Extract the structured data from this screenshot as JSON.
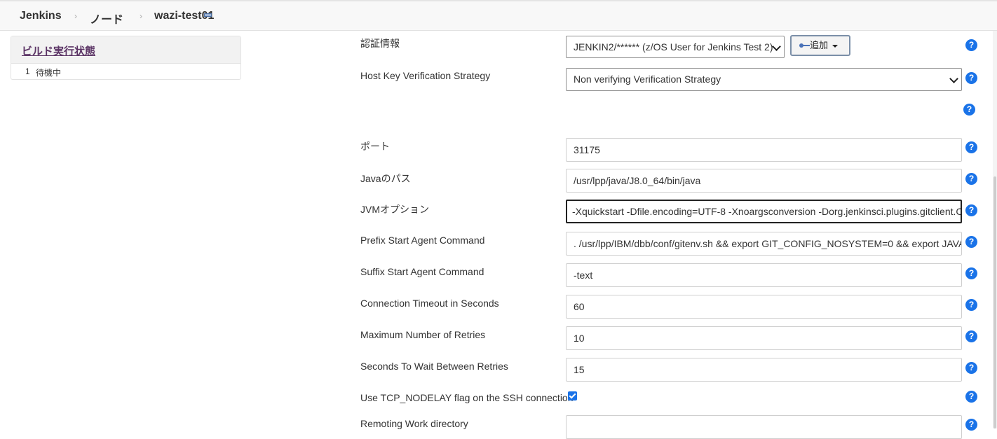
{
  "breadcrumb": {
    "items": [
      "Jenkins",
      "ノード",
      "wazi-test01"
    ],
    "separator": "›"
  },
  "sidebar": {
    "title": "ビルド実行状態",
    "executors": [
      {
        "number": "1",
        "status": "待機中"
      }
    ]
  },
  "form": {
    "credentials": {
      "label": "認証情報",
      "selected": "JENKIN2/****** (z/OS User for Jenkins Test 2)",
      "add_label": "追加"
    },
    "host_key": {
      "label": "Host Key Verification Strategy",
      "selected": "Non verifying Verification Strategy"
    },
    "port": {
      "label": "ポート",
      "value": "31175"
    },
    "java_path": {
      "label": "Javaのパス",
      "value": "/usr/lpp/java/J8.0_64/bin/java"
    },
    "jvm_options": {
      "label": "JVMオプション",
      "value": "-Xquickstart -Dfile.encoding=UTF-8 -Xnoargsconversion -Dorg.jenkinsci.plugins.gitclient.C"
    },
    "prefix_cmd": {
      "label": "Prefix Start Agent Command",
      "value": ". /usr/lpp/IBM/dbb/conf/gitenv.sh && export GIT_CONFIG_NOSYSTEM=0 && export JAVA"
    },
    "suffix_cmd": {
      "label": "Suffix Start Agent Command",
      "value": " -text"
    },
    "timeout": {
      "label": "Connection Timeout in Seconds",
      "value": "60"
    },
    "max_retries": {
      "label": "Maximum Number of Retries",
      "value": "10"
    },
    "retry_wait": {
      "label": "Seconds To Wait Between Retries",
      "value": "15"
    },
    "tcp_nodelay": {
      "label": "Use TCP_NODELAY flag on the SSH connection",
      "checked": true
    },
    "remoting_dir": {
      "label": "Remoting Work directory",
      "value": ""
    }
  },
  "help_glyph": "?",
  "colors": {
    "help": "#1a73e8",
    "sidebar_title": "#5c3566",
    "checkbox": "#1a73e8"
  }
}
